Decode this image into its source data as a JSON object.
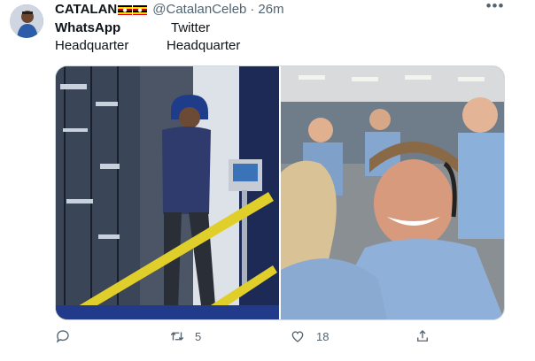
{
  "tweet": {
    "display_name": "CATALAN",
    "flags": [
      "flag-icon",
      "flag-icon"
    ],
    "handle": "@CatalanCeleb",
    "separator": "·",
    "time": "26m",
    "lines": [
      {
        "left": "WhatsApp",
        "right": "Twitter"
      },
      {
        "left": "Headquarter",
        "right": "Headquarter"
      }
    ],
    "images": [
      "data-center-photo",
      "mission-control-celebration-photo"
    ]
  },
  "actions": {
    "reply_count": "",
    "retweet_count": "5",
    "like_count": "18"
  },
  "colors": {
    "text": "#0f1419",
    "muted": "#536471",
    "border": "#cfd9de"
  }
}
